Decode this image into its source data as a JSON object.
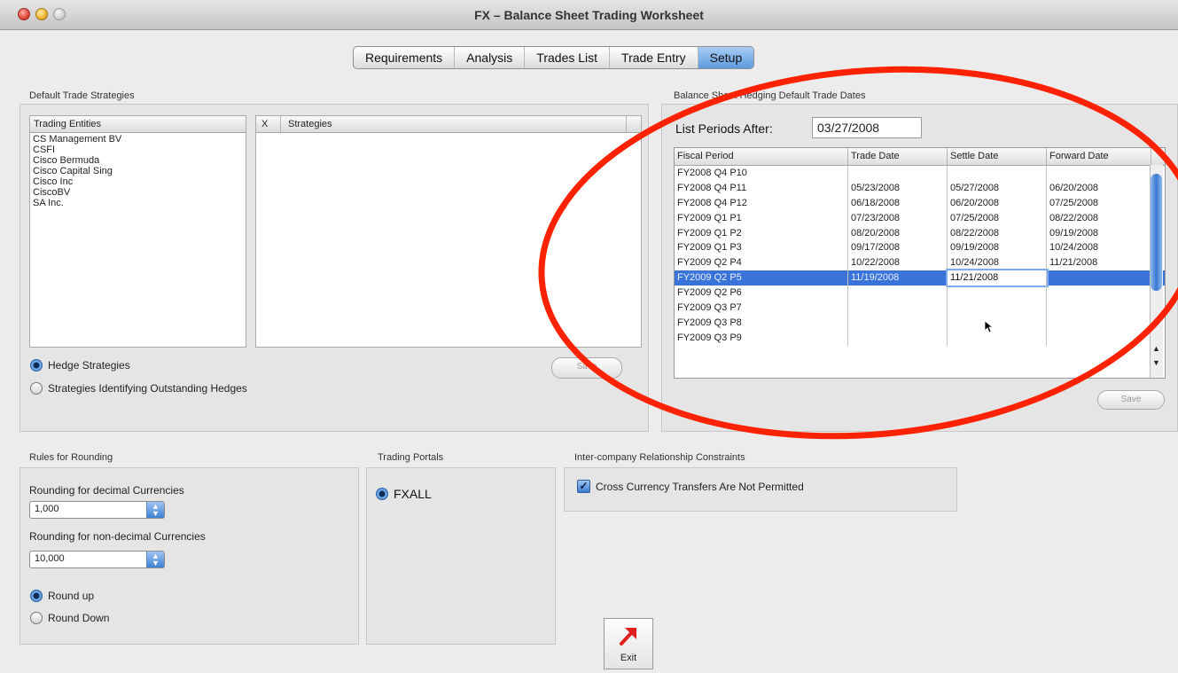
{
  "window": {
    "title": "FX – Balance Sheet Trading Worksheet"
  },
  "tabs": [
    {
      "label": "Requirements"
    },
    {
      "label": "Analysis"
    },
    {
      "label": "Trades List"
    },
    {
      "label": "Trade Entry"
    },
    {
      "label": "Setup",
      "active": true
    }
  ],
  "default_trade_strategies": {
    "group_label": "Default Trade Strategies",
    "entities_header": "Trading Entities",
    "entities": [
      "CS Management BV",
      "CSFI",
      "Cisco Bermuda",
      "Cisco Capital Sing",
      "Cisco Inc",
      "CiscoBV",
      "SA Inc."
    ],
    "x_header": "X",
    "strategies_header": "Strategies",
    "radio_hedge": "Hedge Strategies",
    "radio_outstanding": "Strategies Identifying Outstanding Hedges",
    "save_label": "Save"
  },
  "hedging_dates": {
    "group_label": "Balance Sheet Hedging Default Trade Dates",
    "list_periods_label": "List Periods After:",
    "list_periods_value": "03/27/2008",
    "headers": [
      "Fiscal Period",
      "Trade Date",
      "Settle Date",
      "Forward Date"
    ],
    "rows": [
      [
        "FY2008 Q4 P10",
        "",
        "",
        ""
      ],
      [
        "FY2008 Q4 P11",
        "05/23/2008",
        "05/27/2008",
        "06/20/2008"
      ],
      [
        "FY2008 Q4 P12",
        "06/18/2008",
        "06/20/2008",
        "07/25/2008"
      ],
      [
        "FY2009 Q1 P1",
        "07/23/2008",
        "07/25/2008",
        "08/22/2008"
      ],
      [
        "FY2009 Q1 P2",
        "08/20/2008",
        "08/22/2008",
        "09/19/2008"
      ],
      [
        "FY2009 Q1 P3",
        "09/17/2008",
        "09/19/2008",
        "10/24/2008"
      ],
      [
        "FY2009 Q2 P4",
        "10/22/2008",
        "10/24/2008",
        "11/21/2008"
      ],
      [
        "FY2009 Q2 P5",
        "11/19/2008",
        "11/21/2008",
        ""
      ],
      [
        "FY2009 Q2 P6",
        "",
        "",
        ""
      ],
      [
        "FY2009 Q3 P7",
        "",
        "",
        ""
      ],
      [
        "FY2009 Q3 P8",
        "",
        "",
        ""
      ],
      [
        "FY2009 Q3 P9",
        "",
        "",
        ""
      ]
    ],
    "selected_row": 7,
    "save_label": "Save"
  },
  "rounding": {
    "group_label": "Rules for Rounding",
    "decimal_label": "Rounding for decimal Currencies",
    "decimal_value": "1,000",
    "nondecimal_label": "Rounding for non-decimal Currencies",
    "nondecimal_value": "10,000",
    "round_up": "Round up",
    "round_down": "Round Down"
  },
  "portals": {
    "group_label": "Trading Portals",
    "fxall": "FXALL"
  },
  "constraints": {
    "group_label": "Inter-company Relationship Constraints",
    "cross_currency": "Cross Currency Transfers Are Not Permitted"
  },
  "exit": {
    "label": "Exit"
  },
  "colors": {
    "annotation": "#ff2200",
    "selection": "#3b74d8",
    "exit_arrow": "#e02020"
  }
}
